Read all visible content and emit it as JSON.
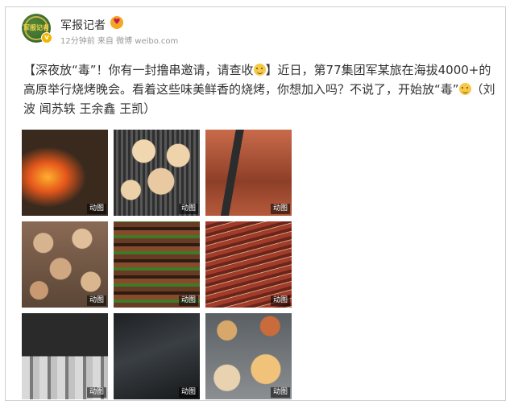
{
  "post": {
    "username": "军报记者",
    "avatar_text": "军报记者",
    "meta": "12分钟前 来自 微博 weibo.com",
    "text_part1": "【深夜放“毒”！你有一封撸串邀请，请查收",
    "text_part2": "】近日，第77集团军某旅在海拔4000+的高原举行烧烤晚会。看着这些味美鲜香的烧烤，你想加入吗？不说了，开始放“毒”",
    "text_part3": "（刘波 闻苏轶 王余鑫 王凯）"
  },
  "images": [
    {
      "tag": "动图"
    },
    {
      "tag": "动图"
    },
    {
      "tag": "动图"
    },
    {
      "tag": "动图"
    },
    {
      "tag": "动图"
    },
    {
      "tag": "动图"
    },
    {
      "tag": "动图"
    },
    {
      "tag": "动图"
    },
    {
      "tag": "动图"
    }
  ],
  "colors": {
    "text": "#333333",
    "meta": "#999999",
    "verified": "#f3b400"
  }
}
